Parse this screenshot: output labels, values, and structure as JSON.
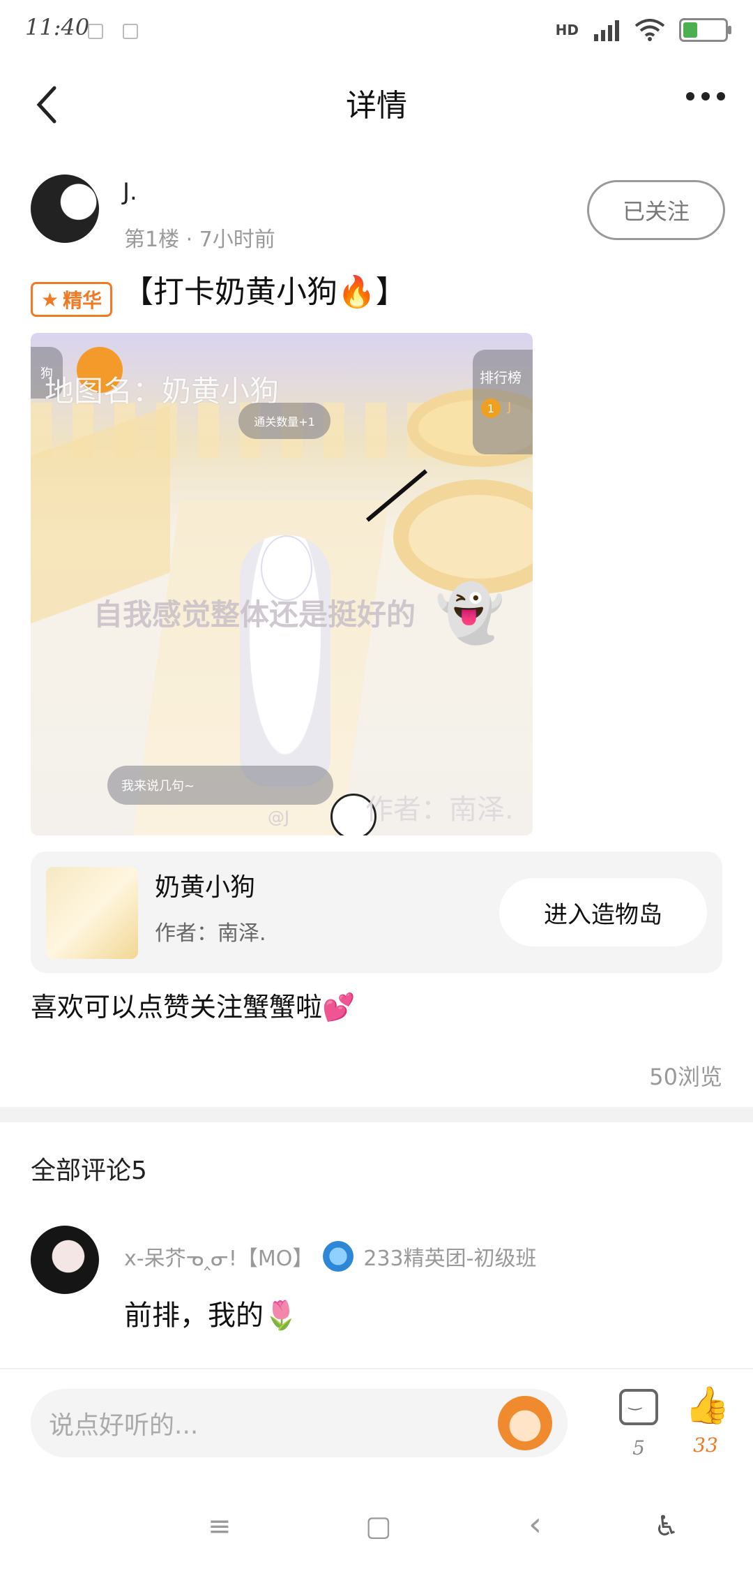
{
  "status_bar": {
    "time": "11:40",
    "network": "HD"
  },
  "header": {
    "title": "详情"
  },
  "post": {
    "username": "J.",
    "meta": "第1楼 · 7小时前",
    "follow_label": "已关注",
    "badge_label": "精华",
    "title": "【打卡奶黄小狗🔥】",
    "image": {
      "watermark_map": "地图名：奶黄小狗",
      "pill_top": "通关数量+1",
      "rank_label": "排行榜",
      "rank_num": "1",
      "rank_user": "J",
      "corner_label": "狗",
      "caption": "自我感觉整体还是挺好的",
      "ghost": "👻",
      "chat_placeholder": "我来说几句~",
      "watermark_author": "作者：南泽.",
      "watermark_at": "@J"
    },
    "map_card": {
      "name": "奶黄小狗",
      "author": "作者：南泽.",
      "enter_label": "进入造物岛"
    },
    "body": "喜欢可以点赞关注蟹蟹啦💕",
    "views": "50浏览"
  },
  "comments": {
    "header": "全部评论5",
    "items": [
      {
        "user": "x-呆芥ᓀ‸ᓂ!【MO】",
        "group": "233精英团-初级班",
        "text": "前排，我的🌷"
      }
    ]
  },
  "bottom_bar": {
    "input_placeholder": "说点好听的...",
    "comment_count": "5",
    "like_count": "33"
  },
  "nav_bar": {
    "menu": "≡",
    "home": "▢",
    "back": "‹",
    "accessibility": "♿"
  },
  "colors": {
    "accent": "#f07a24",
    "muted": "#999999"
  }
}
